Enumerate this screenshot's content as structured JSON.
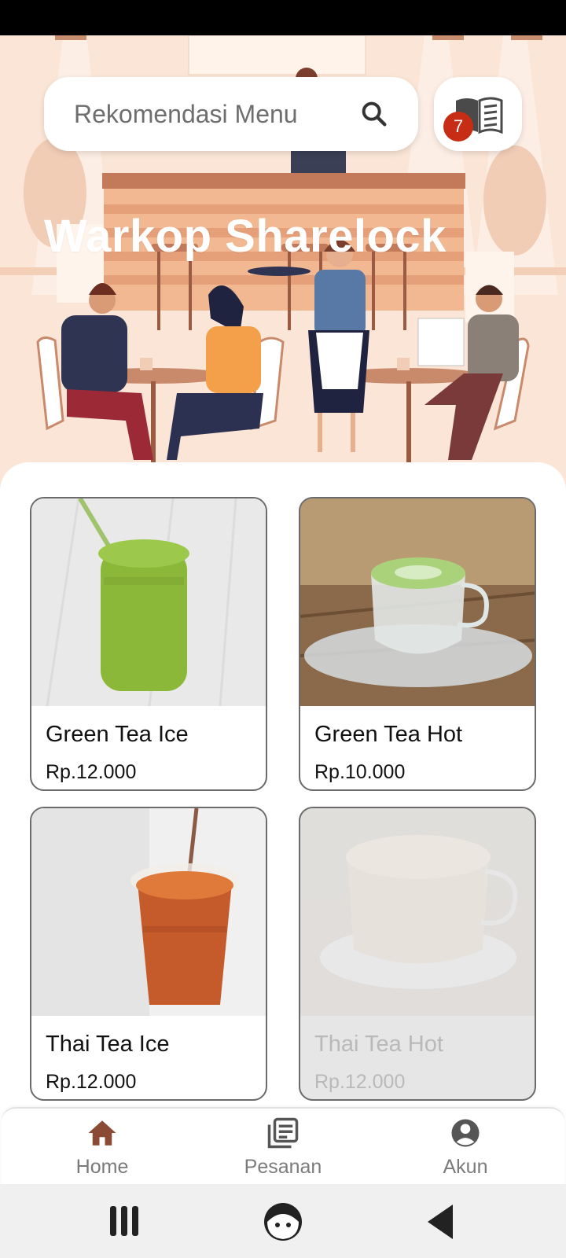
{
  "search": {
    "placeholder": "Rekomendasi Menu"
  },
  "cart": {
    "icon": "menu-book-icon",
    "badge_count": "7"
  },
  "store": {
    "title": "Warkop Sharelock"
  },
  "products": [
    {
      "name": "Green Tea Ice",
      "price": "Rp.12.000",
      "available": true
    },
    {
      "name": "Green Tea Hot",
      "price": "Rp.10.000",
      "available": true
    },
    {
      "name": "Thai Tea Ice",
      "price": "Rp.12.000",
      "available": true
    },
    {
      "name": "Thai Tea Hot",
      "price": "Rp.12.000",
      "available": false
    }
  ],
  "bottom_nav": {
    "items": [
      {
        "label": "Home",
        "icon": "home-icon",
        "active": true
      },
      {
        "label": "Pesanan",
        "icon": "orders-icon",
        "active": false
      },
      {
        "label": "Akun",
        "icon": "account-icon",
        "active": false
      }
    ]
  },
  "colors": {
    "accent": "#8b4a34",
    "badge": "#c62d14",
    "hero_bg": "#fbe5d6"
  }
}
